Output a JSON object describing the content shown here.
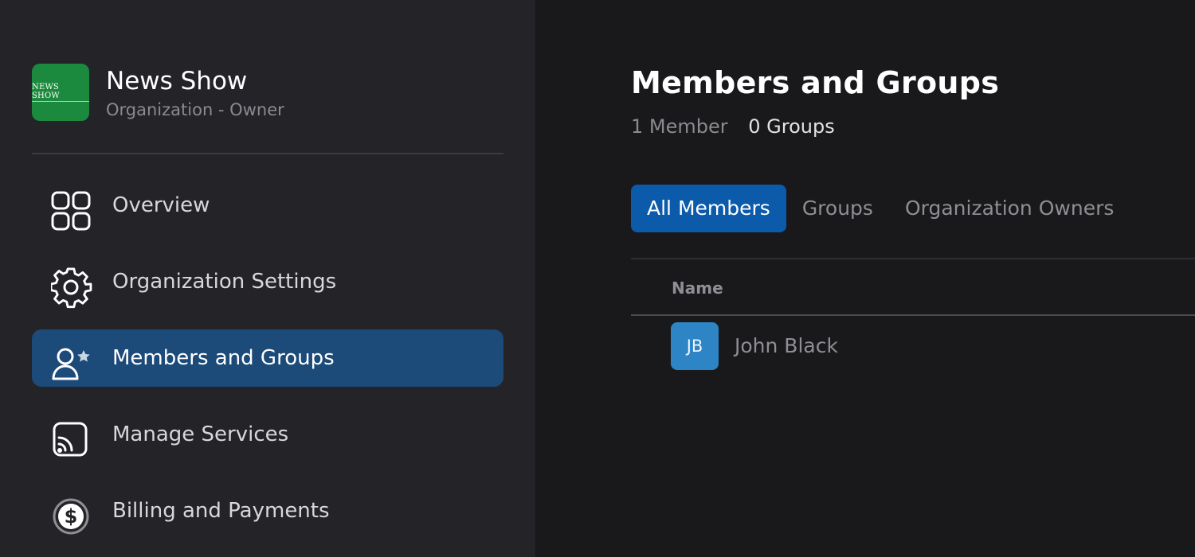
{
  "org": {
    "logo_text": "NEWS SHOW",
    "name": "News Show",
    "role": "Organization - Owner"
  },
  "sidebar": {
    "items": [
      {
        "label": "Overview",
        "icon": "grid-icon",
        "active": false
      },
      {
        "label": "Organization Settings",
        "icon": "gear-icon",
        "active": false
      },
      {
        "label": "Members and Groups",
        "icon": "user-star-icon",
        "active": true
      },
      {
        "label": "Manage Services",
        "icon": "cast-icon",
        "active": false
      },
      {
        "label": "Billing and Payments",
        "icon": "dollar-circle-icon",
        "active": false
      }
    ]
  },
  "main": {
    "title": "Members and Groups",
    "member_count": "1 Member",
    "group_count": "0 Groups",
    "tabs": [
      {
        "label": "All Members",
        "active": true
      },
      {
        "label": "Groups",
        "active": false
      },
      {
        "label": "Organization Owners",
        "active": false
      }
    ],
    "table": {
      "columns": [
        "Name"
      ],
      "rows": [
        {
          "initials": "JB",
          "name": "John Black"
        }
      ]
    }
  },
  "colors": {
    "background": "#19191c",
    "sidebar": "#232328",
    "active_nav": "#1c4a79",
    "active_tab": "#0c5aaa",
    "avatar": "#2d85c6",
    "logo": "#1b8a3e"
  }
}
